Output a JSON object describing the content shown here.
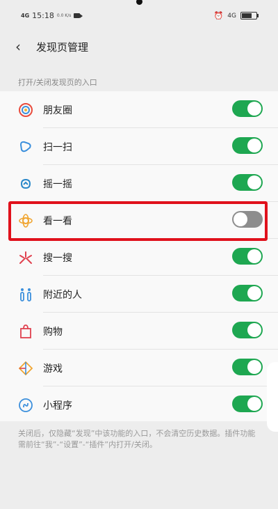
{
  "status_bar": {
    "network": "4G",
    "time": "15:18",
    "speed": "0.0 K/s",
    "signal_right": "4G"
  },
  "header": {
    "back_icon": "chevron-left-icon",
    "title": "发现页管理"
  },
  "section_label": "打开/关闭发现页的入口",
  "items": [
    {
      "label": "朋友圈",
      "icon": "moments-icon",
      "enabled": true
    },
    {
      "label": "扫一扫",
      "icon": "scan-icon",
      "enabled": true
    },
    {
      "label": "摇一摇",
      "icon": "shake-icon",
      "enabled": true
    },
    {
      "label": "看一看",
      "icon": "top-stories-icon",
      "enabled": false
    },
    {
      "label": "搜一搜",
      "icon": "search-icon",
      "enabled": true
    },
    {
      "label": "附近的人",
      "icon": "people-nearby-icon",
      "enabled": true
    },
    {
      "label": "购物",
      "icon": "shopping-bag-icon",
      "enabled": true
    },
    {
      "label": "游戏",
      "icon": "games-icon",
      "enabled": true
    },
    {
      "label": "小程序",
      "icon": "mini-program-icon",
      "enabled": true
    }
  ],
  "footer_text": "关闭后，仅隐藏“发现”中该功能的入口，不会清空历史数据。插件功能需前往“我”-“设置”-“插件”内打开/关闭。",
  "colors": {
    "toggle_on": "#1ea751",
    "toggle_off": "#8d8d8d",
    "highlight": "#e0111c"
  }
}
